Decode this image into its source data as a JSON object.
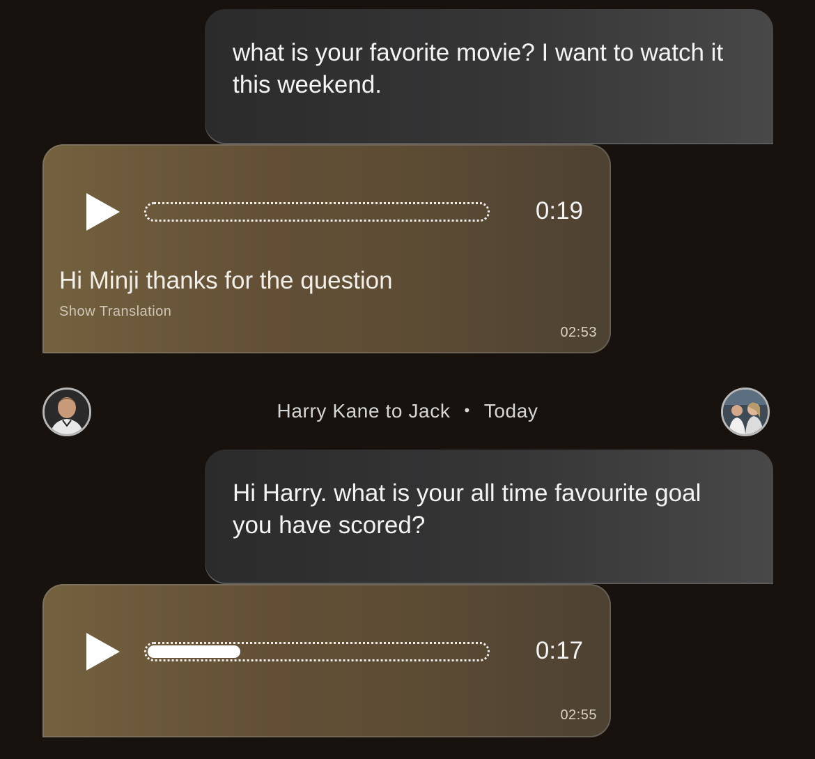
{
  "messages": [
    {
      "text": "what is your favorite movie? I want to watch it this weekend."
    },
    {
      "duration": "0:19",
      "progress": 0,
      "transcript": "Hi Minji thanks for the question",
      "show_translation_label": "Show Translation",
      "timestamp": "02:53"
    },
    {
      "text": "Hi Harry. what is your all time favourite goal you have scored?"
    },
    {
      "duration": "0:17",
      "progress": 0.28,
      "timestamp": "02:55"
    }
  ],
  "header": {
    "sender": "Harry Kane to Jack",
    "separator": "•",
    "when": "Today"
  },
  "icons": {
    "play": "play-icon"
  },
  "colors": {
    "background": "#17120d",
    "outgoing_bubble": "#363637",
    "incoming_bubble": "#624f36"
  }
}
